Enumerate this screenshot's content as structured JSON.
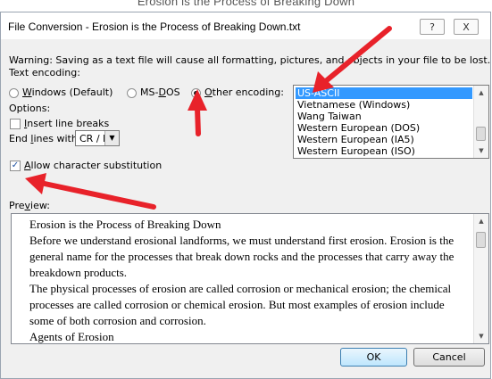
{
  "background_document": {
    "visible_text": "Erosion is the Process of Breaking Down"
  },
  "dialog": {
    "title": "File Conversion - Erosion is the Process of Breaking Down.txt",
    "help_label": "?",
    "close_label": "X"
  },
  "warning": "Warning: Saving as a text file will cause all formatting, pictures, and objects in your file to be lost.",
  "text_encoding": {
    "label": "Text encoding:",
    "options": [
      {
        "pre": "",
        "key": "W",
        "post": "indows (Default)",
        "selected": false
      },
      {
        "pre": "MS-",
        "key": "D",
        "post": "OS",
        "selected": false
      },
      {
        "pre": "",
        "key": "O",
        "post": "ther encoding:",
        "selected": true
      }
    ]
  },
  "encodings": {
    "items": [
      "US-ASCII",
      "Vietnamese (Windows)",
      "Wang Taiwan",
      "Western European (DOS)",
      "Western European (IA5)",
      "Western European (ISO)"
    ],
    "selected": "US-ASCII"
  },
  "options": {
    "label": "Options:",
    "insert_line_breaks": {
      "pre": "",
      "key": "I",
      "post": "nsert line breaks",
      "checked": false
    },
    "end_lines": {
      "pre": "End ",
      "key": "l",
      "post": "ines with:",
      "value": "CR / LF"
    },
    "allow_substitution": {
      "pre": "",
      "key": "A",
      "post": "llow character substitution",
      "checked": true
    }
  },
  "preview": {
    "label_pre": "Pre",
    "label_key": "v",
    "label_post": "iew:",
    "lines": [
      "Erosion is the Process of Breaking Down",
      "Before we understand erosional landforms, we must understand first erosion. Erosion is the",
      "general name for the processes that break down rocks and the processes that carry away the",
      "breakdown products.",
      "The physical processes of erosion are called corrosion or mechanical erosion; the chemical",
      "processes are called corrosion or chemical erosion. But most examples of erosion include",
      "some of both corrosion and corrosion.",
      "Agents of Erosion"
    ]
  },
  "buttons": {
    "ok": "OK",
    "cancel": "Cancel"
  },
  "colors": {
    "arrow": "#e8222a",
    "selection": "#3399ff",
    "dialog_bg": "#f0f0f0"
  },
  "icons": {
    "check": "checkmark-icon",
    "radio": "radio-dot-icon",
    "scroll_up": "triangle-up-icon",
    "scroll_down": "triangle-down-icon",
    "dropdown": "triangle-down-icon"
  }
}
